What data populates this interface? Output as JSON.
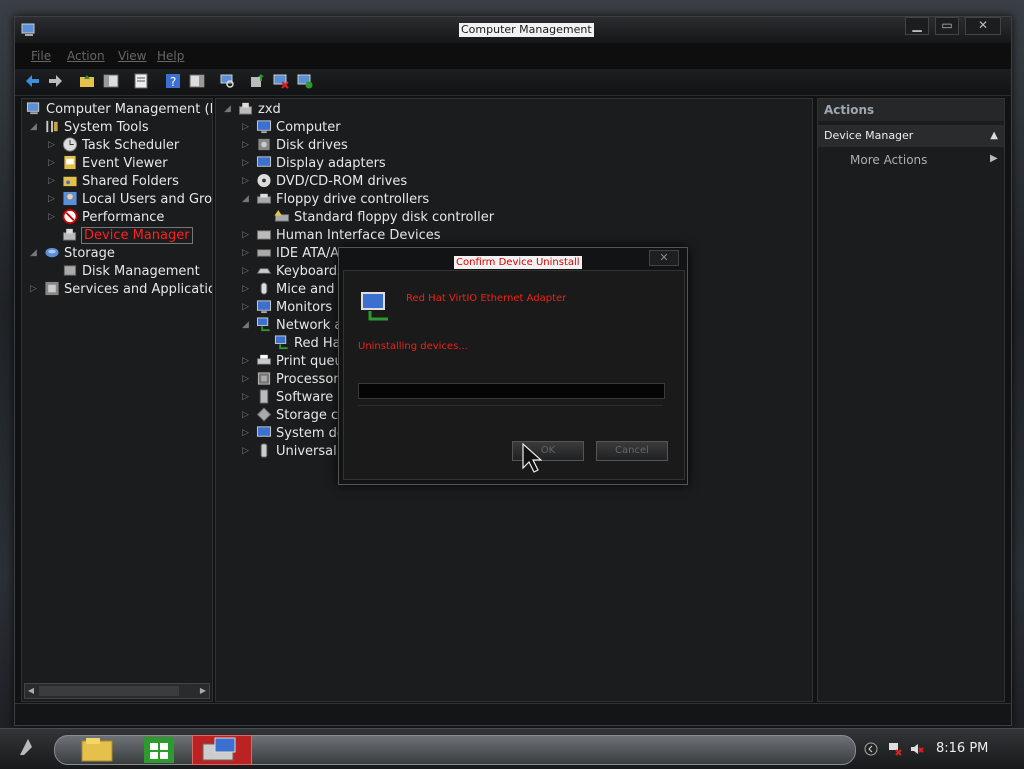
{
  "window": {
    "title": "Computer Management",
    "controls": {
      "minimize": "▁",
      "maximize": "▭",
      "close": "✕"
    }
  },
  "menu": [
    "File",
    "Action",
    "View",
    "Help"
  ],
  "left_tree": [
    {
      "label": "Computer Management (Local)",
      "level": 0,
      "icon": "computer-management-icon"
    },
    {
      "label": "System Tools",
      "level": 1,
      "icon": "tools-icon"
    },
    {
      "label": "Task Scheduler",
      "level": 2,
      "icon": "clock-icon"
    },
    {
      "label": "Event Viewer",
      "level": 2,
      "icon": "event-viewer-icon"
    },
    {
      "label": "Shared Folders",
      "level": 2,
      "icon": "shared-folder-icon"
    },
    {
      "label": "Local Users and Groups",
      "level": 2,
      "icon": "users-icon"
    },
    {
      "label": "Performance",
      "level": 2,
      "icon": "performance-icon"
    },
    {
      "label": "Device Manager",
      "level": 2,
      "icon": "device-manager-icon",
      "selected": true
    },
    {
      "label": "Storage",
      "level": 1,
      "icon": "storage-icon"
    },
    {
      "label": "Disk Management",
      "level": 2,
      "icon": "disk-icon"
    },
    {
      "label": "Services and Applications",
      "level": 1,
      "icon": "services-icon"
    }
  ],
  "device_tree": [
    {
      "label": "zxd",
      "level": 0,
      "icon": "computer-icon"
    },
    {
      "label": "Computer",
      "level": 1,
      "icon": "monitor-icon"
    },
    {
      "label": "Disk drives",
      "level": 1,
      "icon": "disk-drive-icon"
    },
    {
      "label": "Display adapters",
      "level": 1,
      "icon": "display-adapter-icon"
    },
    {
      "label": "DVD/CD-ROM drives",
      "level": 1,
      "icon": "cdrom-icon"
    },
    {
      "label": "Floppy drive controllers",
      "level": 1,
      "icon": "floppy-controller-icon"
    },
    {
      "label": "Standard floppy disk controller",
      "level": 2,
      "icon": "floppy-controller-icon"
    },
    {
      "label": "Human Interface Devices",
      "level": 1,
      "icon": "hid-icon"
    },
    {
      "label": "IDE ATA/AT",
      "level": 1,
      "icon": "ide-icon"
    },
    {
      "label": "Keyboards",
      "level": 1,
      "icon": "keyboard-icon"
    },
    {
      "label": "Mice and c",
      "level": 1,
      "icon": "mouse-icon"
    },
    {
      "label": "Monitors",
      "level": 1,
      "icon": "monitor-icon"
    },
    {
      "label": "Network a",
      "level": 1,
      "icon": "network-adapter-icon"
    },
    {
      "label": "Red Ha",
      "level": 2,
      "icon": "network-adapter-icon"
    },
    {
      "label": "Print queu",
      "level": 1,
      "icon": "printer-icon"
    },
    {
      "label": "Processor",
      "level": 1,
      "icon": "processor-icon"
    },
    {
      "label": "Software d",
      "level": 1,
      "icon": "software-device-icon"
    },
    {
      "label": "Storage co",
      "level": 1,
      "icon": "storage-controller-icon"
    },
    {
      "label": "System de",
      "level": 1,
      "icon": "system-device-icon"
    },
    {
      "label": "Universal S",
      "level": 1,
      "icon": "usb-icon"
    }
  ],
  "actions": {
    "header": "Actions",
    "section": "Device Manager",
    "more": "More Actions"
  },
  "dialog": {
    "title": "Confirm Device Uninstall",
    "device": "Red Hat VirtIO Ethernet Adapter",
    "status": "Uninstalling devices...",
    "ok": "OK",
    "cancel": "Cancel",
    "close": "✕"
  },
  "taskbar": {
    "clock": "8:16 PM",
    "apps": [
      "file-explorer-icon",
      "store-icon",
      "computer-management-icon"
    ]
  },
  "colors": {
    "accent": "#ff2020",
    "background": "#1b1c1d"
  }
}
